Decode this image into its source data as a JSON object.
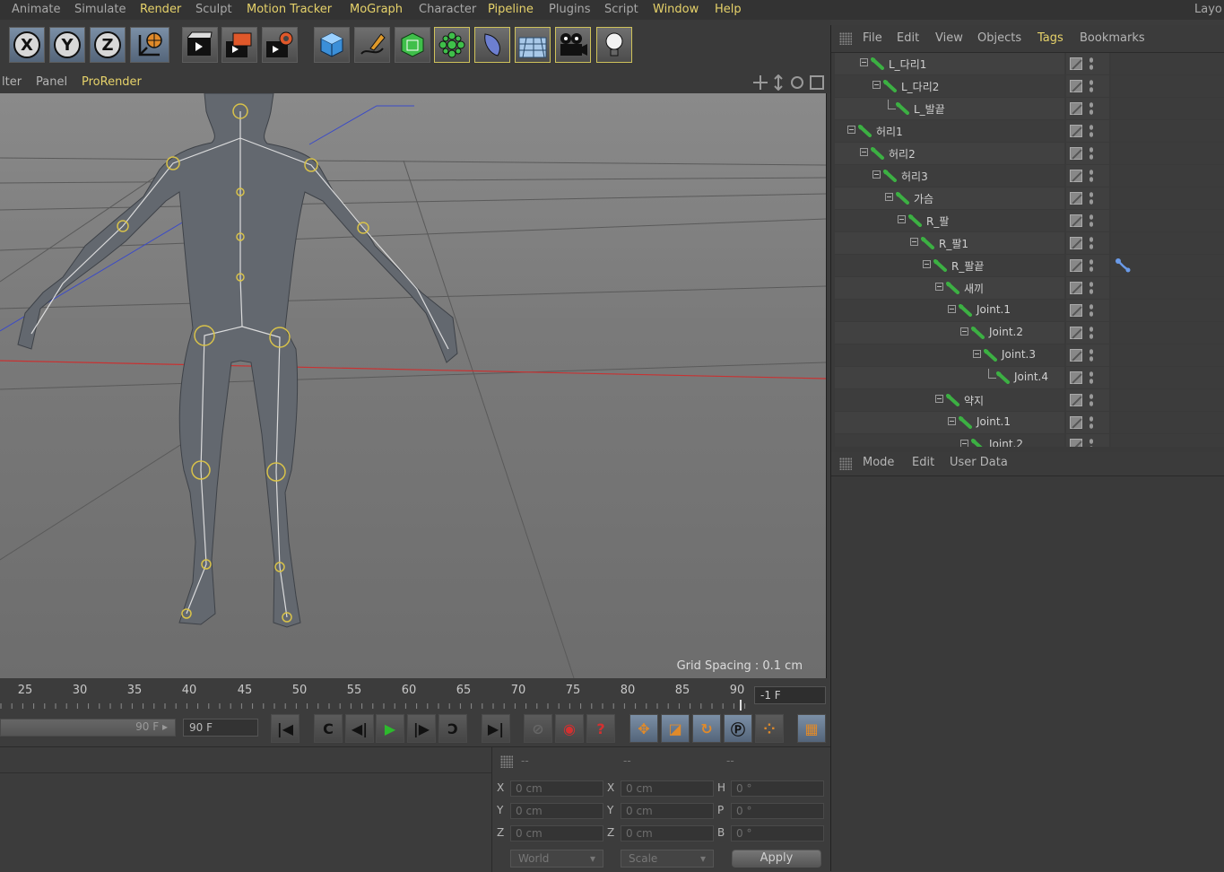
{
  "menubar": {
    "items": [
      "Animate",
      "Simulate",
      "Render",
      "Sculpt",
      "Motion Tracker",
      "MoGraph",
      "Character",
      "Pipeline",
      "Plugins",
      "Script",
      "Window",
      "Help"
    ],
    "highlighted": [
      "Render",
      "Motion Tracker",
      "MoGraph",
      "Pipeline",
      "Window",
      "Help"
    ],
    "layout_label": "Layo"
  },
  "toolbar": {
    "axis_x": "X",
    "axis_y": "Y",
    "axis_z": "Z",
    "icons": [
      "axis-x-lock-icon",
      "axis-y-lock-icon",
      "axis-z-lock-icon",
      "world-coordinate-icon",
      "render-view-icon",
      "render-picture-viewer-icon",
      "render-settings-icon",
      "cube-icon",
      "pen-spline-icon",
      "subdivision-icon",
      "array-cloner-icon",
      "deformer-icon",
      "floor-icon",
      "camera-icon",
      "light-icon"
    ]
  },
  "viewport": {
    "menus": [
      "lter",
      "Panel",
      "ProRender"
    ],
    "grid_spacing": "Grid Spacing : 0.1 cm"
  },
  "timeline": {
    "ticks": [
      "25",
      "30",
      "35",
      "40",
      "45",
      "50",
      "55",
      "60",
      "65",
      "70",
      "75",
      "80",
      "85",
      "90"
    ],
    "current_frame": "-1 F",
    "end_frame_slider": "90 F",
    "end_frame_field": "90 F"
  },
  "playback": {
    "icons": [
      "go-to-start-icon",
      "previous-key-icon",
      "previous-frame-icon",
      "play-icon",
      "next-frame-icon",
      "next-key-icon",
      "go-to-end-icon",
      "record-disabled-icon",
      "autokey-icon",
      "keyframe-selection-icon",
      "move-key-icon",
      "scale-key-icon",
      "rotate-key-icon",
      "param-key-icon",
      "pla-key-icon",
      "timeline-window-icon"
    ]
  },
  "coordinates": {
    "headers": [
      "--",
      "--",
      "--"
    ],
    "position": [
      {
        "axis": "X",
        "value": "0 cm"
      },
      {
        "axis": "Y",
        "value": "0 cm"
      },
      {
        "axis": "Z",
        "value": "0 cm"
      }
    ],
    "size": [
      {
        "axis": "X",
        "value": "0 cm"
      },
      {
        "axis": "Y",
        "value": "0 cm"
      },
      {
        "axis": "Z",
        "value": "0 cm"
      }
    ],
    "rotation": [
      {
        "axis": "H",
        "value": "0 °"
      },
      {
        "axis": "P",
        "value": "0 °"
      },
      {
        "axis": "B",
        "value": "0 °"
      }
    ],
    "coord_system": "World",
    "mode": "Scale",
    "apply": "Apply"
  },
  "object_manager": {
    "menus": [
      "File",
      "Edit",
      "View",
      "Objects",
      "Tags",
      "Bookmarks"
    ],
    "rows": [
      {
        "label": "L_다리1",
        "level": 1,
        "expand": true
      },
      {
        "label": "L_다리2",
        "level": 2,
        "expand": true
      },
      {
        "label": "L_발끝",
        "level": 3,
        "expand": false
      },
      {
        "label": "허리1",
        "level": 0,
        "expand": true
      },
      {
        "label": "허리2",
        "level": 1,
        "expand": true
      },
      {
        "label": "허리3",
        "level": 2,
        "expand": true
      },
      {
        "label": "가슴",
        "level": 3,
        "expand": true
      },
      {
        "label": "R_팔",
        "level": 4,
        "expand": true
      },
      {
        "label": "R_팔1",
        "level": 5,
        "expand": true
      },
      {
        "label": "R_팔끝",
        "level": 6,
        "expand": true,
        "tag": "ik-tag-icon"
      },
      {
        "label": "새끼",
        "level": 7,
        "expand": true
      },
      {
        "label": "Joint.1",
        "level": 8,
        "expand": true
      },
      {
        "label": "Joint.2",
        "level": 9,
        "expand": true
      },
      {
        "label": "Joint.3",
        "level": 10,
        "expand": true
      },
      {
        "label": "Joint.4",
        "level": 11,
        "expand": false
      },
      {
        "label": "약지",
        "level": 7,
        "expand": true
      },
      {
        "label": "Joint.1",
        "level": 8,
        "expand": true
      },
      {
        "label": "Joint.2",
        "level": 9,
        "expand": true
      }
    ]
  },
  "attribute_manager": {
    "menus": [
      "Mode",
      "Edit",
      "User Data"
    ]
  },
  "colors": {
    "highlight": "#e6d26a",
    "bone": "#3cb043",
    "x_axis": "#c83232"
  }
}
